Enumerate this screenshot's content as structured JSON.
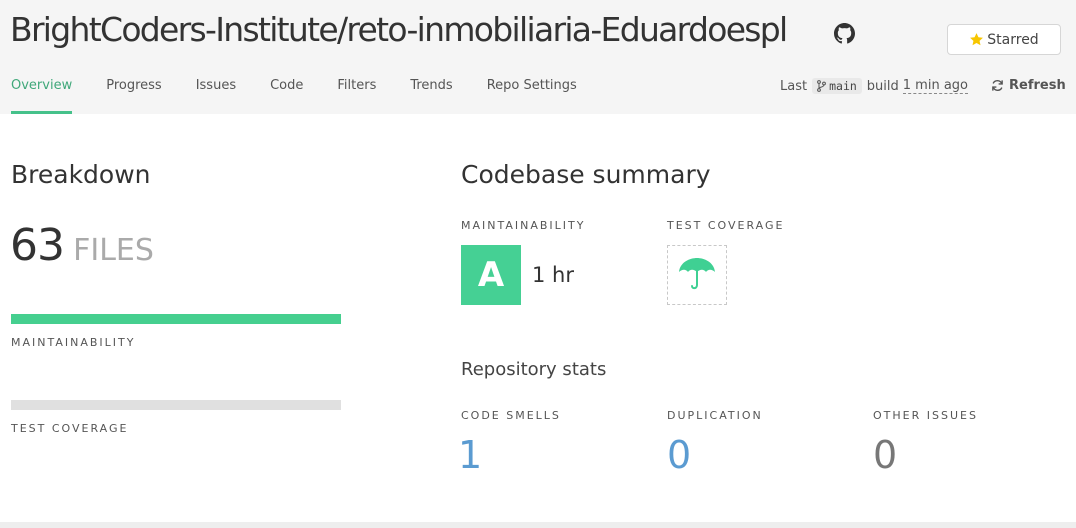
{
  "header": {
    "repo_title": "BrightCoders-Institute/reto-inmobiliaria-Eduardoespl",
    "github_icon": "github-icon",
    "star_button": {
      "label": "Starred",
      "icon": "star-icon",
      "star_color": "#f7c600"
    }
  },
  "tabs": [
    {
      "label": "Overview",
      "active": true
    },
    {
      "label": "Progress"
    },
    {
      "label": "Issues"
    },
    {
      "label": "Code"
    },
    {
      "label": "Filters"
    },
    {
      "label": "Trends"
    },
    {
      "label": "Repo Settings"
    }
  ],
  "build": {
    "prefix": "Last",
    "branch_icon": "git-branch-icon",
    "branch": "main",
    "middle": "build",
    "ago": "1 min ago"
  },
  "refresh": {
    "label": "Refresh",
    "icon": "refresh-icon"
  },
  "breakdown": {
    "title": "Breakdown",
    "files_count": "63",
    "files_label": "FILES",
    "maintainability_label": "MAINTAINABILITY",
    "maintainability_fraction": 1.0,
    "test_coverage_label": "TEST COVERAGE",
    "test_coverage_fraction": 0
  },
  "summary": {
    "title": "Codebase summary",
    "maintainability_label": "MAINTAINABILITY",
    "grade": "A",
    "debt": "1 hr",
    "test_coverage_label": "TEST COVERAGE",
    "coverage_icon": "umbrella-icon",
    "stats_title": "Repository stats",
    "stats": [
      {
        "label": "CODE SMELLS",
        "value": "1"
      },
      {
        "label": "DUPLICATION",
        "value": "0"
      },
      {
        "label": "OTHER ISSUES",
        "value": "0"
      }
    ]
  },
  "colors": {
    "accent_green": "#45c18a",
    "grade_a": "#45d094",
    "link_blue": "#5b9bd1",
    "muted_gray": "#777777"
  }
}
